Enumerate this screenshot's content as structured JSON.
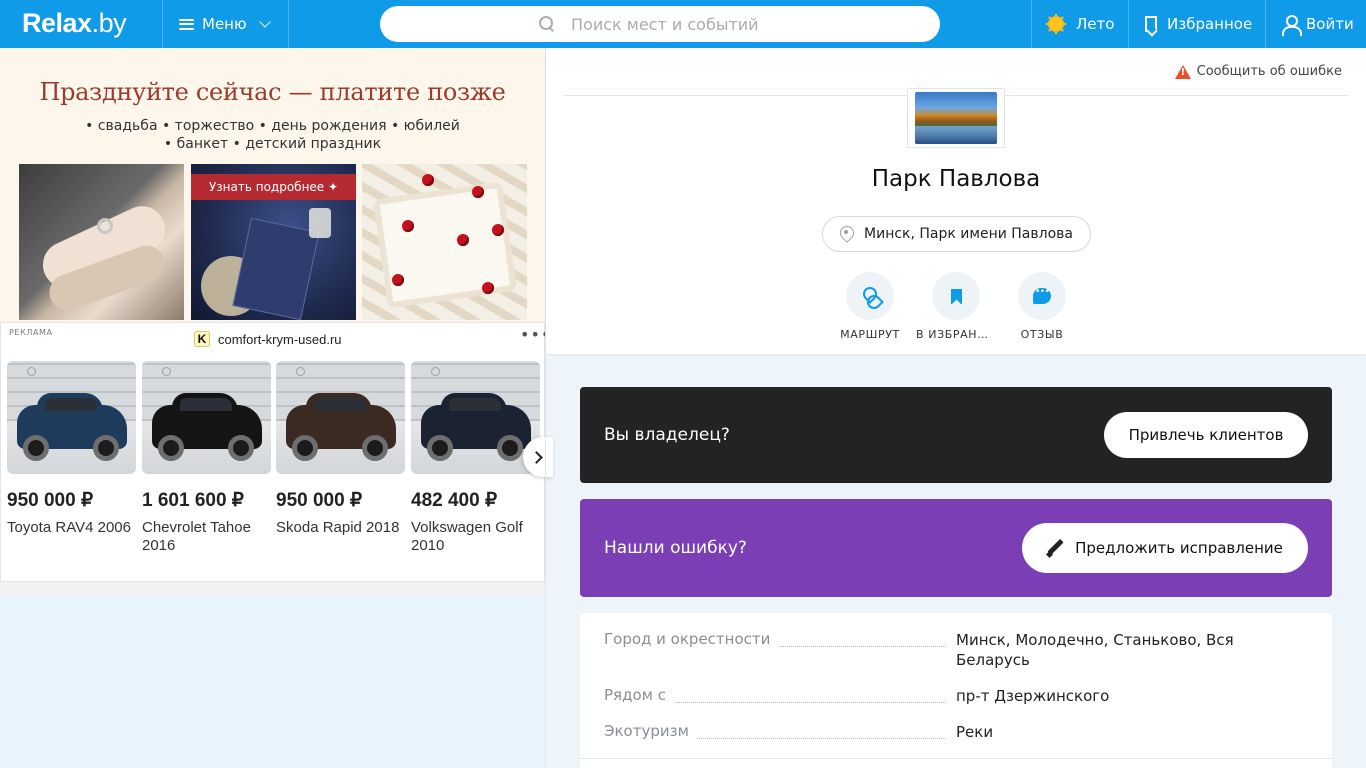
{
  "header": {
    "logo_main": "Relax",
    "logo_suffix": ".by",
    "menu_label": "Меню",
    "search_placeholder": "Поиск мест и событий",
    "season_label": "Лето",
    "favorites_label": "Избранное",
    "login_label": "Войти",
    "brand_color": "#0f9be8"
  },
  "ad_top": {
    "title": "Празднуйте сейчас — платите позже",
    "line1": "• свадьба • торжество • день рождения • юбилей",
    "line2": "• банкет • детский праздник",
    "cta": "Узнать подробнее ✦"
  },
  "ad_cars": {
    "label": "РЕКЛАМА",
    "domain_icon": "K",
    "domain": "comfort-krym-used.ru",
    "menu_dots": "•••",
    "cars": [
      {
        "price": "950 000 ₽",
        "name": "Toyota RAV4 2006",
        "color": "#1f3b5c"
      },
      {
        "price": "1 601 600 ₽",
        "name": "Chevrolet Tahoe 2016",
        "color": "#141414"
      },
      {
        "price": "950 000 ₽",
        "name": "Skoda Rapid 2018",
        "color": "#3a2a22"
      },
      {
        "price": "482 400 ₽",
        "name": "Volkswagen Golf 2010",
        "color": "#1b2333"
      }
    ]
  },
  "place": {
    "report_label": "Сообщить об ошибке",
    "title": "Парк Павлова",
    "address": "Минск, Парк имени Павлова",
    "actions": [
      {
        "label": "МАРШРУТ",
        "icon": "route-icon"
      },
      {
        "label": "В ИЗБРАННОЕ",
        "icon": "bookmark-icon"
      },
      {
        "label": "ОТЗЫВ",
        "icon": "review-icon"
      }
    ]
  },
  "owner_block": {
    "text": "Вы владелец?",
    "button": "Привлечь клиентов"
  },
  "error_block": {
    "text": "Нашли ошибку?",
    "button": "Предложить исправление",
    "color": "#7b3eb5"
  },
  "info": {
    "rows": [
      {
        "key": "Город и окрестности",
        "value": "Минск, Молодечно, Станьково, Вся Беларусь"
      },
      {
        "key": "Рядом с",
        "value": "пр-т Дзержинского"
      },
      {
        "key": "Экотуризм",
        "value": "Реки"
      }
    ]
  }
}
